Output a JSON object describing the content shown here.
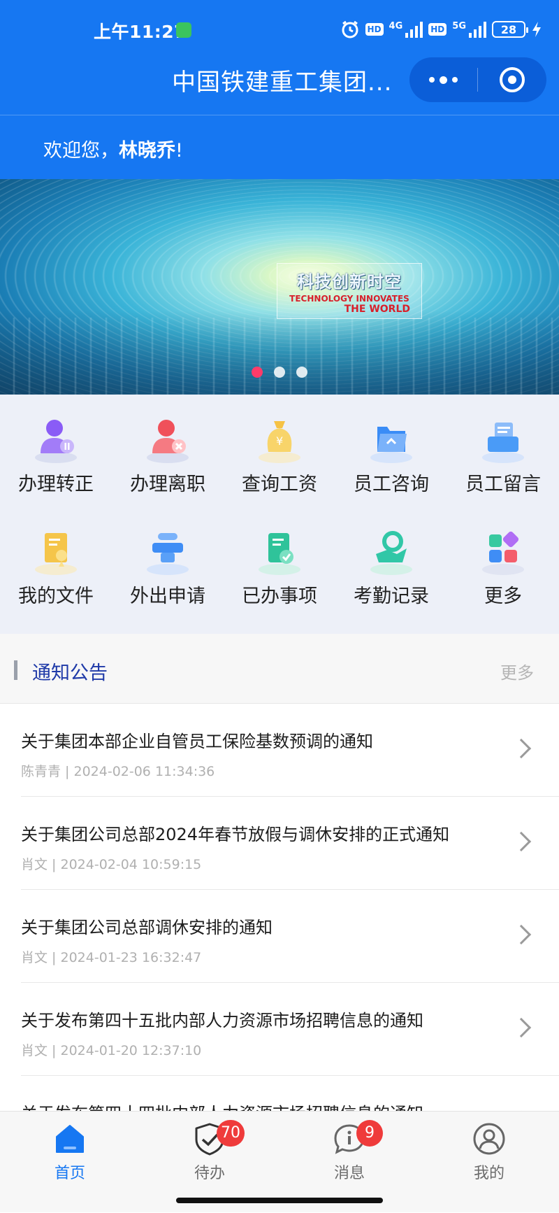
{
  "status_bar": {
    "time": "上午11:27",
    "network_1": "4G",
    "network_2": "5G",
    "hd_1": "HD",
    "hd_2": "HD",
    "battery": "28"
  },
  "header": {
    "title": "中国铁建重工集团..."
  },
  "welcome": {
    "prefix": "欢迎您，",
    "name": "林晓乔",
    "suffix": "!"
  },
  "banner": {
    "title_cn": "科技创新时空",
    "line1": "TECHNOLOGY INNOVATES",
    "line2": "THE WORLD",
    "slides": 3,
    "active_slide": 1
  },
  "grid": {
    "items": [
      {
        "label": "办理转正",
        "icon": "user-pause-icon",
        "color": "#8a5cf6"
      },
      {
        "label": "办理离职",
        "icon": "user-remove-icon",
        "color": "#f0505a"
      },
      {
        "label": "查询工资",
        "icon": "money-bag-icon",
        "color": "#f6c244"
      },
      {
        "label": "员工咨询",
        "icon": "folder-icon",
        "color": "#3a8cf6"
      },
      {
        "label": "员工留言",
        "icon": "message-box-icon",
        "color": "#4a9bf7"
      },
      {
        "label": "我的文件",
        "icon": "document-icon",
        "color": "#f5c54a"
      },
      {
        "label": "外出申请",
        "icon": "travel-icon",
        "color": "#3f8df5"
      },
      {
        "label": "已办事项",
        "icon": "done-document-icon",
        "color": "#2fc39a"
      },
      {
        "label": "考勤记录",
        "icon": "attendance-icon",
        "color": "#31c7a7"
      },
      {
        "label": "更多",
        "icon": "apps-icon",
        "color": "#f45d6b"
      }
    ]
  },
  "notice": {
    "title": "通知公告",
    "more": "更多",
    "items": [
      {
        "title": "关于集团本部企业自管员工保险基数预调的通知",
        "meta": "陈青青 | 2024-02-06 11:34:36"
      },
      {
        "title": "关于集团公司总部2024年春节放假与调休安排的正式通知",
        "meta": "肖文 | 2024-02-04 10:59:15"
      },
      {
        "title": "关于集团公司总部调休安排的通知",
        "meta": "肖文 | 2024-01-23 16:32:47"
      },
      {
        "title": "关于发布第四十五批内部人力资源市场招聘信息的通知",
        "meta": "肖文 | 2024-01-20 12:37:10"
      },
      {
        "title": "关于发布第四十四批内部人力资源市场招聘信息的通知",
        "meta": ""
      }
    ]
  },
  "tabs": [
    {
      "label": "首页",
      "icon": "home-icon",
      "badge": ""
    },
    {
      "label": "待办",
      "icon": "shield-check-icon",
      "badge": "70"
    },
    {
      "label": "消息",
      "icon": "message-icon",
      "badge": "9"
    },
    {
      "label": "我的",
      "icon": "user-icon",
      "badge": ""
    }
  ],
  "colors": {
    "primary": "#1677f2",
    "badge": "#ef3b3b",
    "notice_title": "#1f3aa8"
  }
}
